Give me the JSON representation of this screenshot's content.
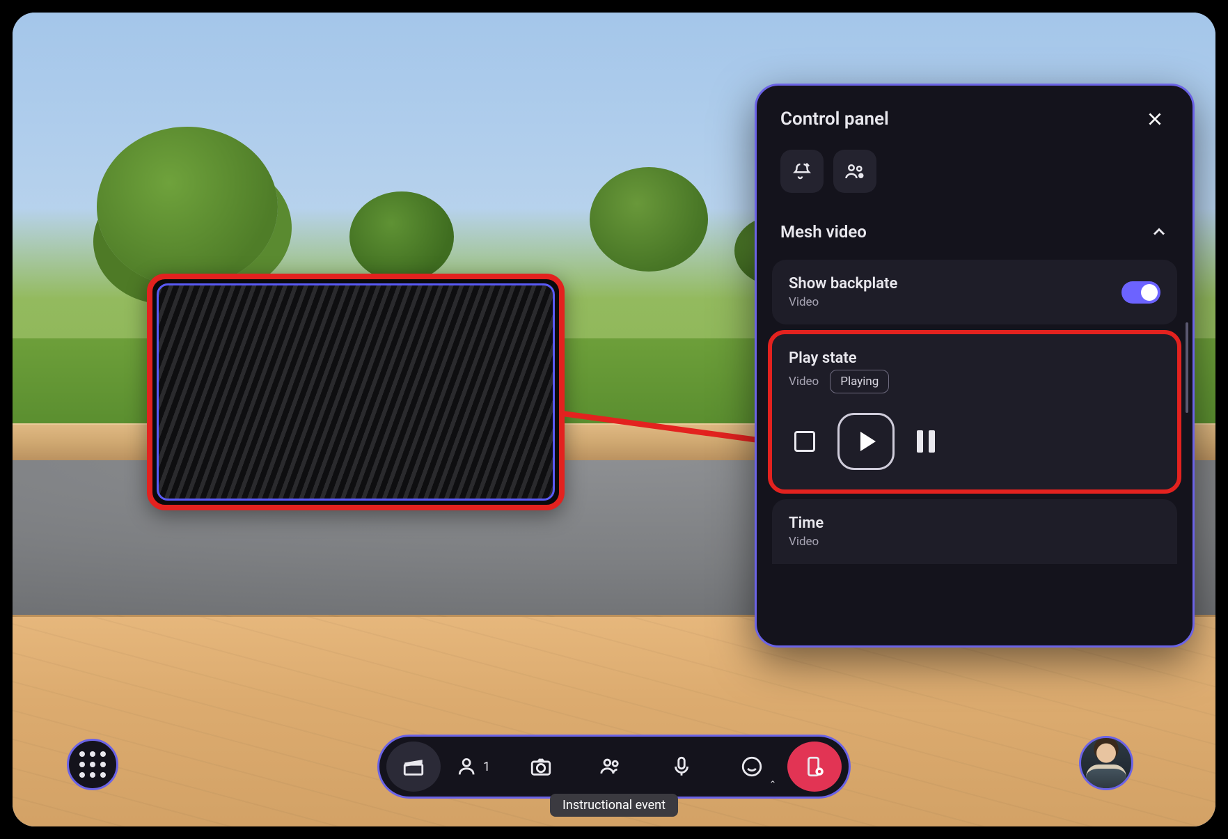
{
  "panel": {
    "title": "Control panel",
    "section": {
      "title": "Mesh video",
      "backplate": {
        "title": "Show backplate",
        "sub": "Video"
      },
      "playstate": {
        "title": "Play state",
        "sub": "Video",
        "badge": "Playing"
      },
      "time": {
        "title": "Time",
        "sub": "Video"
      }
    }
  },
  "dock": {
    "people_count": "1"
  },
  "event_label": "Instructional event",
  "colors": {
    "accent": "#6b63e6",
    "highlight": "#e3221f",
    "danger": "#e23454"
  }
}
